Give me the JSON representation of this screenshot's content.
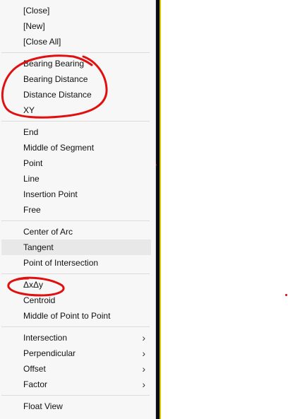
{
  "menu": {
    "items": [
      {
        "label": "[Close]"
      },
      {
        "label": "[New]"
      },
      {
        "label": "[Close All]"
      },
      {
        "label": "Bearing Bearing"
      },
      {
        "label": "Bearing Distance"
      },
      {
        "label": "Distance Distance"
      },
      {
        "label": "XY"
      },
      {
        "label": "End"
      },
      {
        "label": "Middle of Segment"
      },
      {
        "label": "Point"
      },
      {
        "label": "Line"
      },
      {
        "label": "Insertion Point"
      },
      {
        "label": "Free"
      },
      {
        "label": "Center of Arc"
      },
      {
        "label": "Tangent"
      },
      {
        "label": "Point of Intersection"
      },
      {
        "label": "ΔxΔy"
      },
      {
        "label": "Centroid"
      },
      {
        "label": "Middle of Point to Point"
      },
      {
        "label": "Intersection"
      },
      {
        "label": "Perpendicular"
      },
      {
        "label": "Offset"
      },
      {
        "label": "Factor"
      },
      {
        "label": "Float View"
      }
    ],
    "submenu_glyph": "›"
  },
  "colors": {
    "annotation": "#e01010",
    "hover": "#e8e8e8",
    "menu_bg": "#f7f7f7"
  }
}
